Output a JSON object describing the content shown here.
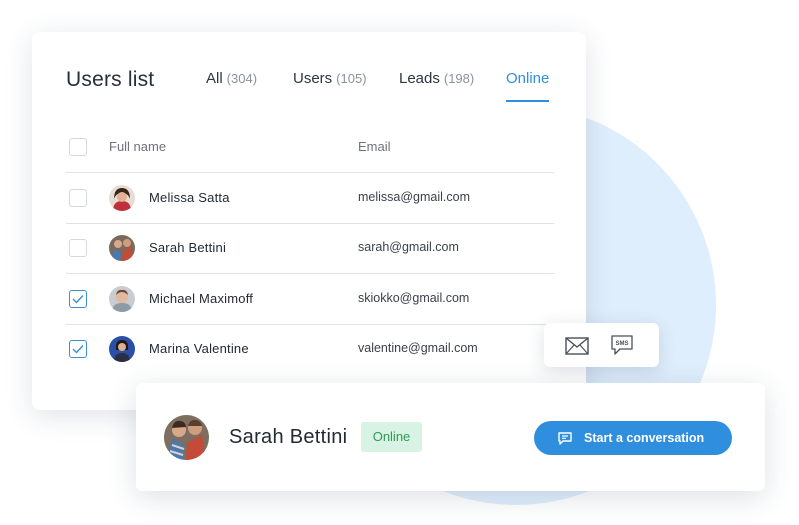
{
  "card": {
    "title": "Users list",
    "tabs": [
      {
        "label": "All",
        "count": "(304)"
      },
      {
        "label": "Users",
        "count": "(105)"
      },
      {
        "label": "Leads",
        "count": "(198)"
      },
      {
        "label": "Online",
        "count": ""
      }
    ],
    "active_tab": "Online",
    "columns": {
      "name": "Full name",
      "email": "Email"
    },
    "rows": [
      {
        "name": "Melissa Satta",
        "email": "melissa@gmail.com",
        "checked": false
      },
      {
        "name": "Sarah Bettini",
        "email": "sarah@gmail.com",
        "checked": false
      },
      {
        "name": "Michael Maximoff",
        "email": "skiokko@gmail.com",
        "checked": true
      },
      {
        "name": "Marina Valentine",
        "email": "valentine@gmail.com",
        "checked": true
      }
    ]
  },
  "popover": {
    "icons": [
      "mail-icon",
      "sms-icon"
    ],
    "sms_text": "SMS"
  },
  "conversation": {
    "name": "Sarah Bettini",
    "status": "Online",
    "button_label": "Start a conversation",
    "button_icon": "chat-icon"
  },
  "colors": {
    "accent": "#2f8fde",
    "online_badge_bg": "#d8f3e3",
    "online_badge_text": "#2f9a55",
    "background_circle": "#dfeefc"
  }
}
